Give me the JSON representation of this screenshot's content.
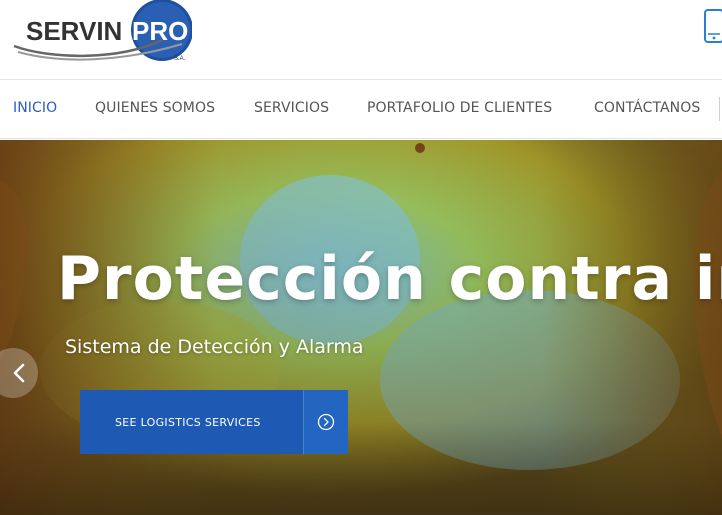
{
  "header": {
    "logo_text_left": "SERVIN",
    "logo_text_right": "PRO",
    "logo_suffix": "S.A.",
    "phone_icon": "mobile-phone-icon"
  },
  "nav": {
    "items": [
      {
        "label": "INICIO",
        "active": true
      },
      {
        "label": "QUIENES SOMOS",
        "active": false
      },
      {
        "label": "SERVICIOS",
        "active": false
      },
      {
        "label": "PORTAFOLIO DE CLIENTES",
        "active": false
      },
      {
        "label": "CONTÁCTANOS",
        "active": false
      }
    ]
  },
  "hero": {
    "title": "Protección contra incendios",
    "subtitle": "Sistema de Detección y Alarma",
    "cta_label": "SEE LOGISTICS SERVICES",
    "cta_icon": "arrow-right-circle-icon",
    "prev_icon": "chevron-left-icon"
  },
  "colors": {
    "accent": "#2a5cc8",
    "cta_bg": "#1e5ab3",
    "nav_text": "#555555"
  }
}
